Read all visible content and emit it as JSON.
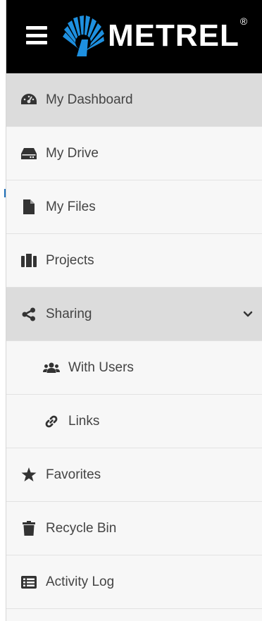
{
  "header": {
    "menu_icon": "hamburger-icon",
    "logo_text": "METREL",
    "logo_reg": "®",
    "background": "#000000",
    "logo_accent": "#1e90e0"
  },
  "nav": {
    "items": [
      {
        "label": "My Dashboard",
        "icon": "dashboard-icon",
        "active": true
      },
      {
        "label": "My Drive",
        "icon": "drive-icon"
      },
      {
        "label": "My Files",
        "icon": "file-icon"
      },
      {
        "label": "Projects",
        "icon": "projects-icon"
      },
      {
        "label": "Sharing",
        "icon": "share-icon",
        "expanded": true,
        "chevron": "chevron-down-icon"
      },
      {
        "label": "With Users",
        "icon": "users-icon",
        "sub": true
      },
      {
        "label": "Links",
        "icon": "link-icon",
        "sub": true
      },
      {
        "label": "Favorites",
        "icon": "star-icon"
      },
      {
        "label": "Recycle Bin",
        "icon": "trash-icon"
      },
      {
        "label": "Activity Log",
        "icon": "activity-log-icon"
      }
    ]
  },
  "colors": {
    "text": "#444444",
    "icon": "#333333",
    "active_bg": "#dcdcdc",
    "sidebar_bg": "#f7f7f7"
  }
}
